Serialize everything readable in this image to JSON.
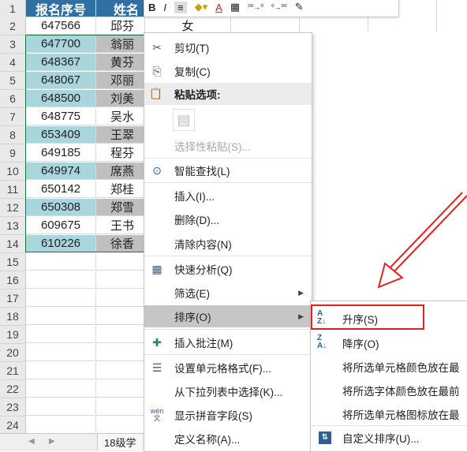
{
  "headers": {
    "col_b": "报名序号",
    "col_c": "姓名"
  },
  "rows": [
    {
      "n": "2",
      "id": "647566",
      "name": "邱芬",
      "d": "女"
    },
    {
      "n": "3",
      "id": "647700",
      "name": "翁丽"
    },
    {
      "n": "4",
      "id": "648367",
      "name": "黄芬"
    },
    {
      "n": "5",
      "id": "648067",
      "name": "邓丽"
    },
    {
      "n": "6",
      "id": "648500",
      "name": "刘美"
    },
    {
      "n": "7",
      "id": "648775",
      "name": "吴水"
    },
    {
      "n": "8",
      "id": "653409",
      "name": "王翠"
    },
    {
      "n": "9",
      "id": "649185",
      "name": "程芬"
    },
    {
      "n": "10",
      "id": "649974",
      "name": "席燕"
    },
    {
      "n": "11",
      "id": "650142",
      "name": "郑桂"
    },
    {
      "n": "12",
      "id": "650308",
      "name": "郑雪"
    },
    {
      "n": "13",
      "id": "609675",
      "name": "王书"
    },
    {
      "n": "14",
      "id": "610226",
      "name": "徐香"
    }
  ],
  "empty_rows": [
    "15",
    "16",
    "17",
    "18",
    "19",
    "20",
    "21",
    "22",
    "23",
    "24"
  ],
  "row1_label": "1",
  "sheet_tab": "18级学",
  "mini_toolbar": [
    "B",
    "I",
    "≡",
    "A",
    "▦",
    "⁰⁰→⁰",
    "⁰→⁰⁰",
    "✎"
  ],
  "menu": {
    "cut": "剪切(T)",
    "copy": "复制(C)",
    "paste_options": "粘贴选项:",
    "paste_special": "选择性粘贴(S)...",
    "smart_lookup": "智能查找(L)",
    "insert": "插入(I)...",
    "delete": "删除(D)...",
    "clear": "清除内容(N)",
    "quick_analysis": "快速分析(Q)",
    "filter": "筛选(E)",
    "sort": "排序(O)",
    "insert_comment": "插入批注(M)",
    "format_cells": "设置单元格格式(F)...",
    "pick_list": "从下拉列表中选择(K)...",
    "phonetic": "显示拼音字段(S)",
    "define_name": "定义名称(A)..."
  },
  "submenu": {
    "asc": "升序(S)",
    "desc": "降序(O)",
    "cell_color": "将所选单元格颜色放在最",
    "font_color": "将所选字体颜色放在最前",
    "icon": "将所选单元格图标放在最",
    "custom": "自定义排序(U)..."
  },
  "colors": {
    "header": "#2f6fa3",
    "teal": "#a9d6dc",
    "grey": "#bfbfbf",
    "highlight_border": "#e02020",
    "arrow": "#e82020"
  }
}
